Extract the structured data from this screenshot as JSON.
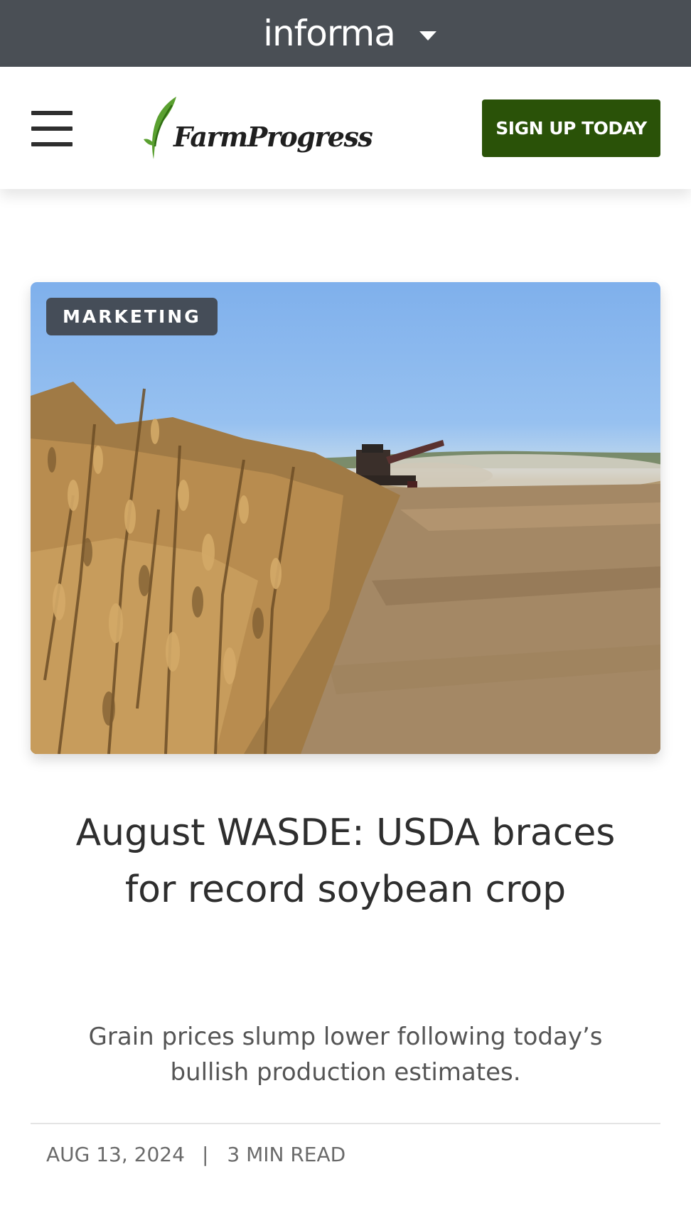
{
  "informa_bar": {
    "logo_text": "informa",
    "caret_icon": "chevron-down-icon"
  },
  "header": {
    "menu_icon": "hamburger-menu-icon",
    "brand_name": "FarmProgress",
    "signup_label": "SIGN UP TODAY",
    "colors": {
      "signup_bg": "#2a5208",
      "brand_leaf": "#5aa030"
    }
  },
  "article": {
    "category": "MARKETING",
    "headline": "August WASDE: USDA braces for record soybean crop",
    "dek": "Grain prices slump lower following today’s bullish production estimates.",
    "date": "AUG 13, 2024",
    "separator": "|",
    "read_time": "3 MIN READ"
  }
}
